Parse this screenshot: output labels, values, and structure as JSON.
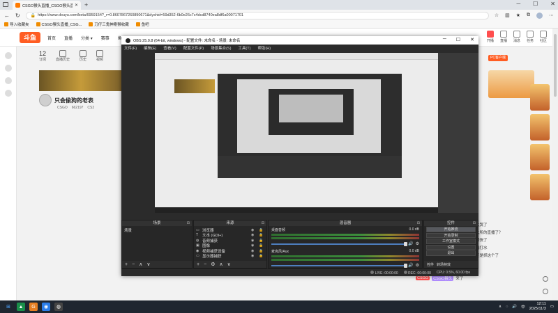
{
  "browser": {
    "tab_title": "CSGO猴头直播_CSGO猴头直播_C...",
    "tab_close": "✕",
    "new_tab": "+",
    "url": "https://www.douyu.com/beta/6959154?_r=0.8607867260890671&dyshid=59d352-6b0e26c7c4dcd8740ea8df6a00071701",
    "win_controls": [
      "─",
      "☐",
      "✕"
    ],
    "bookmarks": [
      "导入收藏夹",
      "CSGO猴头直播_CSG...",
      "刀仔三鬼神刚猴收藏",
      "鱼吧"
    ]
  },
  "douyu": {
    "logo": "斗鱼",
    "nav": [
      "首页",
      "直播",
      "分类 ▾",
      "赛事",
      "鱼吧"
    ],
    "right_items": [
      "开播",
      "直播",
      "消息",
      "任务",
      "社区"
    ],
    "stats": [
      {
        "value": "12",
        "label": "订阅"
      },
      {
        "value": "",
        "label": "直播历史"
      },
      {
        "value": "",
        "label": "历史"
      },
      {
        "value": "",
        "label": "视频"
      }
    ],
    "streamer_name": "只会偷狗的老表",
    "streamer_meta": [
      "CSGO",
      "662197",
      "CS2"
    ],
    "pc_button": "PC客户端",
    "chat_lines": [
      "大哭了",
      "大所的直播了？",
      "猴快了",
      "瑞打水",
      "还是抓这个了",
      "哪里了好",
      "收了"
    ],
    "chat_footer": [
      "CSGO",
      "CSGO猴头",
      "来了"
    ]
  },
  "obs": {
    "title": "OBS 25.0.8 (64-bit, windows) - 配置文件: 未命名 - 场景: 未命名",
    "win_controls": [
      "─",
      "☐",
      "✕"
    ],
    "menu": [
      "文件(F)",
      "编辑(E)",
      "查看(V)",
      "配置文件(P)",
      "场景集合(S)",
      "工具(T)",
      "帮助(H)"
    ],
    "docks": {
      "scenes": {
        "title": "场景",
        "items": [
          "场景"
        ]
      },
      "sources": {
        "title": "来源",
        "items": [
          {
            "icon": "▭",
            "name": "浏览器"
          },
          {
            "icon": "T",
            "name": "文本 (GDI+)"
          },
          {
            "icon": "◍",
            "name": "音频捕获"
          },
          {
            "icon": "▣",
            "name": "图像"
          },
          {
            "icon": "◉",
            "name": "视频捕获设备"
          },
          {
            "icon": "▭",
            "name": "显示器捕获"
          }
        ]
      },
      "mixer": {
        "title": "混音器",
        "tracks": [
          {
            "name": "桌面音频",
            "db": "0.0 dB"
          },
          {
            "name": "麦克风/Aux",
            "db": "0.0 dB"
          }
        ]
      },
      "controls": {
        "title": "控件",
        "buttons": [
          "开始推流",
          "开始录制",
          "工作室模式",
          "设置",
          "退出"
        ],
        "tabs": [
          "控件",
          "转场特效"
        ]
      }
    },
    "dock_footer_icons": [
      "+",
      "−",
      "∧",
      "∨"
    ],
    "source_footer_icons": [
      "+",
      "−",
      "⚙",
      "∧",
      "∨"
    ],
    "status": {
      "live": "LIVE: 00:00:00",
      "rec": "REC: 00:00:00",
      "cpu": "CPU: 0.5%, 60.00 fps"
    }
  },
  "taskbar": {
    "time": "12:11",
    "date": "2025/11/3",
    "lang": "中",
    "apps": [
      "⊞",
      "▲",
      "G",
      "◉",
      "◍"
    ]
  }
}
